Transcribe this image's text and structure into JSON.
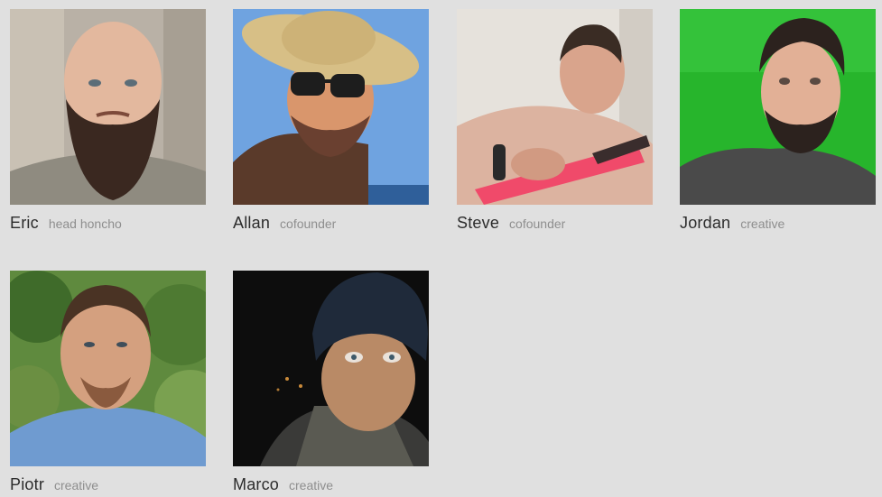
{
  "team": {
    "members": [
      {
        "name": "Eric",
        "role": "head honcho"
      },
      {
        "name": "Allan",
        "role": "cofounder"
      },
      {
        "name": "Steve",
        "role": "cofounder"
      },
      {
        "name": "Jordan",
        "role": "creative"
      },
      {
        "name": "Piotr",
        "role": "creative"
      },
      {
        "name": "Marco",
        "role": "creative"
      }
    ]
  },
  "colors": {
    "page_background": "#e0e0e0",
    "name_text": "#2c2c2c",
    "role_text": "#8e8e8e"
  }
}
